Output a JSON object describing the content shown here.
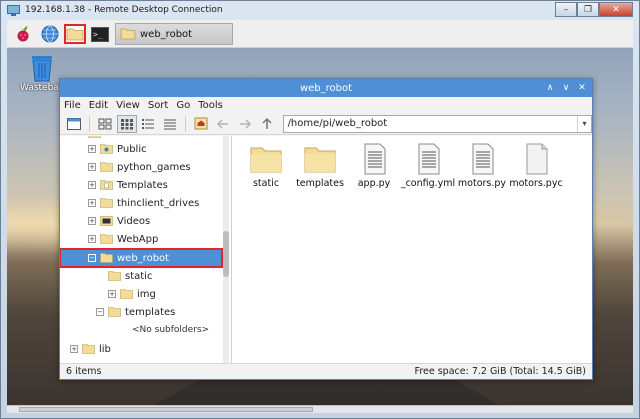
{
  "rdp": {
    "title": "192.168.1.38 - Remote Desktop Connection",
    "minimize_glyph": "–",
    "restore_glyph": "❐",
    "close_glyph": "✕"
  },
  "taskbar": {
    "icons": [
      "raspberry-pi-icon",
      "globe-icon",
      "folder-icon",
      "terminal-icon"
    ],
    "terminal_glyph": ">_",
    "task_label": "web_robot"
  },
  "desktop": {
    "trash_label": "Wasteba"
  },
  "file_manager": {
    "title": "web_robot",
    "window_controls": [
      "∧",
      "∨",
      "✕"
    ],
    "menu": [
      "File",
      "Edit",
      "View",
      "Sort",
      "Go",
      "Tools"
    ],
    "path": "/home/pi/web_robot",
    "tree": [
      {
        "label": "Public",
        "expander": "+"
      },
      {
        "label": "python_games",
        "expander": "+"
      },
      {
        "label": "Templates",
        "expander": "+"
      },
      {
        "label": "thinclient_drives",
        "expander": "+"
      },
      {
        "label": "Videos",
        "expander": "+"
      },
      {
        "label": "WebApp",
        "expander": "+"
      },
      {
        "label": "web_robot",
        "expander": "−",
        "selected": true
      },
      {
        "label": "static",
        "expander": ""
      },
      {
        "label": "img",
        "expander": "+"
      },
      {
        "label": "templates",
        "expander": "−"
      },
      {
        "label": "<No subfolders>",
        "expander": ""
      },
      {
        "label": "lib",
        "expander": "+"
      }
    ],
    "files": [
      {
        "name": "static",
        "type": "folder"
      },
      {
        "name": "templates",
        "type": "folder"
      },
      {
        "name": "app.py",
        "type": "text"
      },
      {
        "name": "_config.yml",
        "type": "text"
      },
      {
        "name": "motors.py",
        "type": "text"
      },
      {
        "name": "motors.pyc",
        "type": "binary"
      }
    ],
    "status_left": "6 items",
    "status_right": "Free space: 7.2 GiB (Total: 14.5 GiB)"
  },
  "colors": {
    "accent": "#4e8fd6",
    "highlight_box": "#e0262b",
    "folder": "#f2dc96"
  }
}
